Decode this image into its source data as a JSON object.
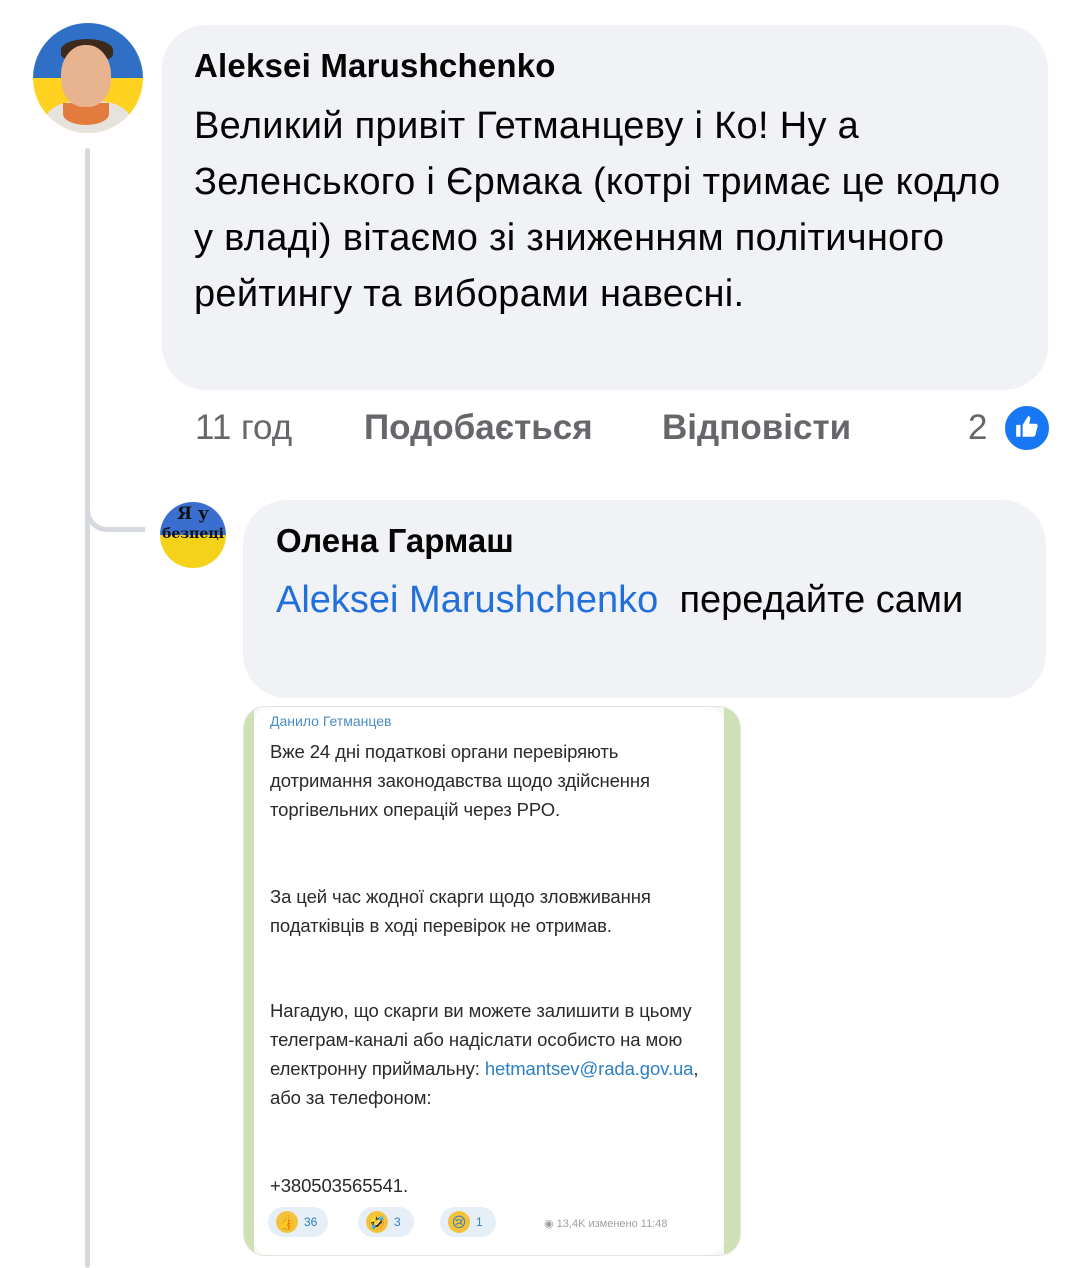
{
  "comment": {
    "author": "Aleksei Marushchenko",
    "text": "Великий привіт Гетманцеву і Ко! Ну а Зеленського і Єрмака (котрі тримає це кодло у владі) вітаємо зі зниженням політичного рейтингу та виборами навесні.",
    "time": "11 год",
    "like_label": "Подобається",
    "reply_label": "Відповісти",
    "reactions_count": "2"
  },
  "reply": {
    "avatar_line1": "Я у",
    "avatar_line2": "безпеці",
    "author": "Олена Гармаш",
    "mention": "Aleksei Marushchenko",
    "text": "передайте сами"
  },
  "attachment": {
    "channel_author": "Данило Гетманцев",
    "paragraph1": "Вже 24 дні податкові органи перевіряють дотримання законодавства щодо здійснення торгівельних операцій через РРО.",
    "paragraph2": "За цей час жодної скарги щодо зловживання податківців в ході перевірок не отримав.",
    "paragraph3_before": "Нагадую, що скарги ви можете залишити в цьому телеграм-каналі або надіслати особисто на мою електронну приймальну:",
    "email": "hetmantsev@rada.gov.ua",
    "paragraph3_after": ", або за телефоном:",
    "phone": "+380503565541.",
    "reactions": [
      {
        "icon": "👍",
        "count": "36"
      },
      {
        "icon": "🤣",
        "count": "3"
      },
      {
        "icon": "😢",
        "count": "1"
      }
    ],
    "views": "13,4K",
    "edited_label": "изменено 11:48"
  },
  "colors": {
    "bubble": "#f0f2f5",
    "link": "#216fdb",
    "meta": "#65676b",
    "like_badge": "#1877f2"
  }
}
